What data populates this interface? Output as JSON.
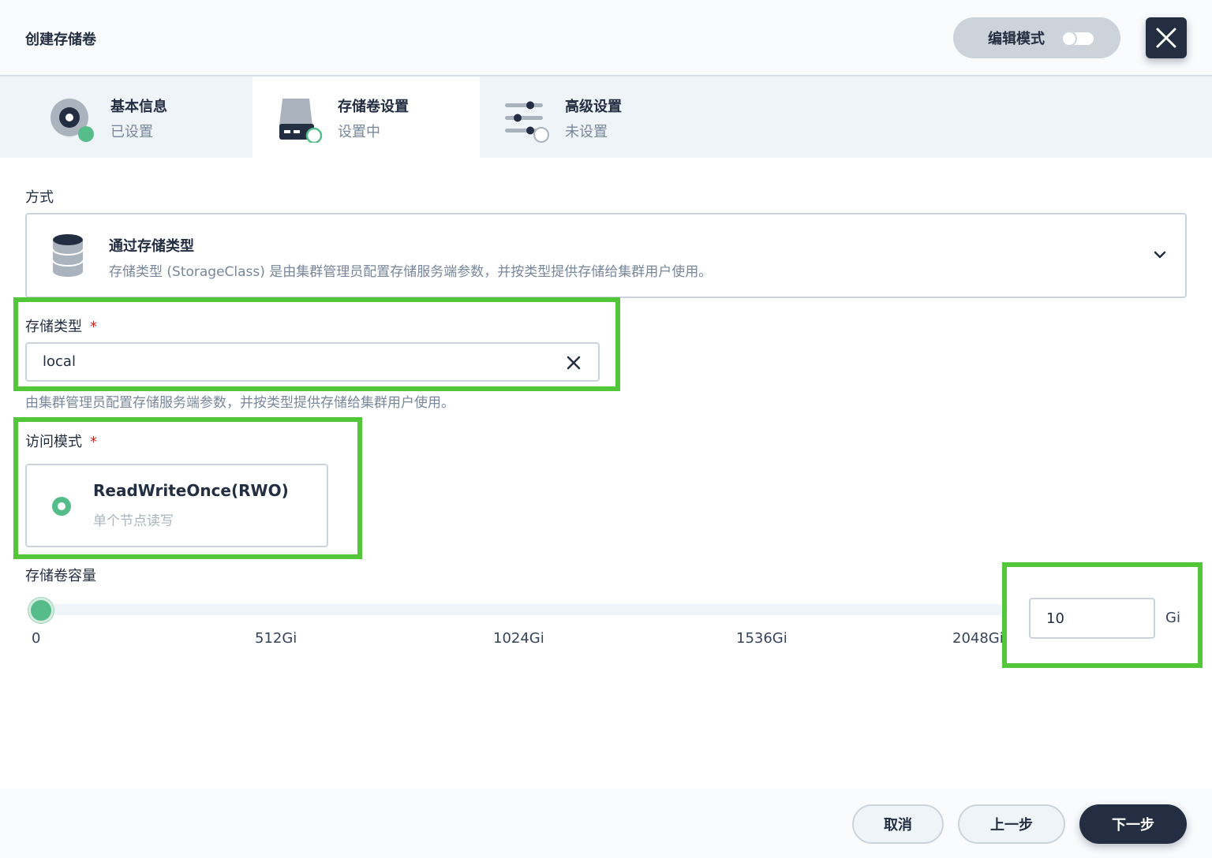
{
  "header": {
    "title": "创建存储卷",
    "edit_mode_label": "编辑模式",
    "edit_mode_on": false
  },
  "steps": [
    {
      "title": "基本信息",
      "status": "已设置",
      "icon": "disk-icon"
    },
    {
      "title": "存储卷设置",
      "status": "设置中",
      "icon": "drive-icon"
    },
    {
      "title": "高级设置",
      "status": "未设置",
      "icon": "sliders-icon"
    }
  ],
  "method": {
    "label": "方式",
    "title": "通过存储类型",
    "description": "存储类型 (StorageClass) 是由集群管理员配置存储服务端参数，并按类型提供存储给集群用户使用。"
  },
  "storage_class": {
    "label": "存储类型",
    "required_mark": "*",
    "value": "local",
    "help": "由集群管理员配置存储服务端参数，并按类型提供存储给集群用户使用。"
  },
  "access_mode": {
    "label": "访问模式",
    "required_mark": "*",
    "option_title": "ReadWriteOnce(RWO)",
    "option_desc": "单个节点读写",
    "selected": true
  },
  "capacity": {
    "label": "存储卷容量",
    "ticks": [
      "0",
      "512Gi",
      "1024Gi",
      "1536Gi",
      "2048Gi"
    ],
    "value": "10",
    "unit": "Gi",
    "slider_min": 0,
    "slider_max": 2048,
    "slider_value": 10
  },
  "footer": {
    "cancel": "取消",
    "prev": "上一步",
    "next": "下一步"
  },
  "colors": {
    "primary_dark": "#242e42",
    "success_green": "#55bc8a",
    "highlight_green": "#52c73a",
    "required_red": "#ca2621"
  }
}
